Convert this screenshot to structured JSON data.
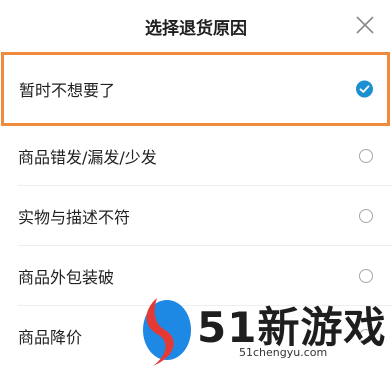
{
  "header": {
    "title": "选择退货原因",
    "close_icon": "close-icon"
  },
  "reasons": [
    {
      "label": "暂时不想要了",
      "selected": true
    },
    {
      "label": "商品错发/漏发/少发",
      "selected": false
    },
    {
      "label": "实物与描述不符",
      "selected": false
    },
    {
      "label": "商品外包装破",
      "selected": false
    },
    {
      "label": "商品降价",
      "selected": false
    }
  ],
  "colors": {
    "accent": "#1c8fd1",
    "highlight_border": "#f08a3c"
  },
  "watermark": {
    "text": "51新游戏",
    "url": "51chengyu.com"
  }
}
